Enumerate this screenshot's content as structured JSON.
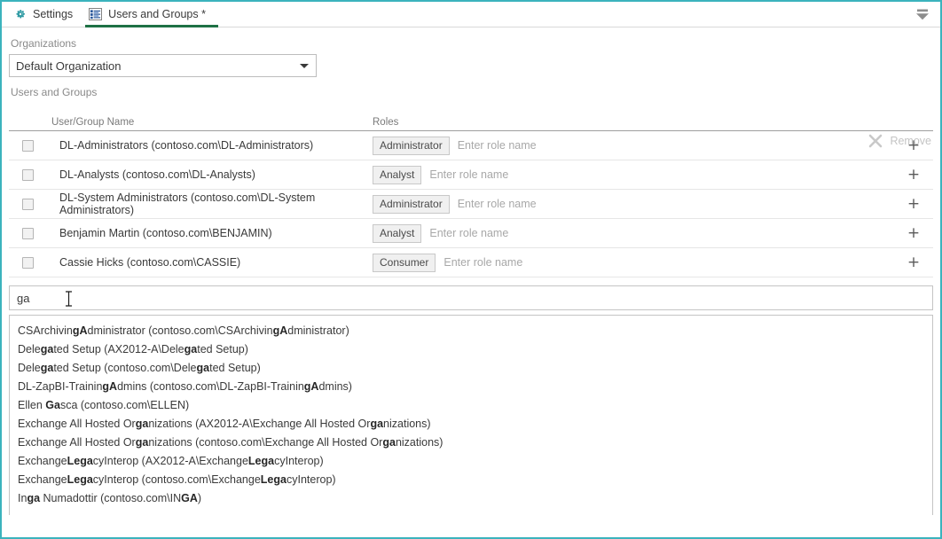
{
  "window": {
    "accent_color": "#3bb3bd",
    "active_tab_underline": "#1e7145"
  },
  "tabs": [
    {
      "label": "Settings",
      "icon": "gear-icon",
      "active": false
    },
    {
      "label": "Users and Groups *",
      "icon": "list-form-icon",
      "active": true
    }
  ],
  "toolbar": {
    "filter_icon": "funnel-icon",
    "remove_label": "Remove",
    "remove_icon": "x-icon"
  },
  "organizations": {
    "label": "Organizations",
    "selected": "Default Organization",
    "caret_icon": "chevron-down-icon"
  },
  "users_and_groups": {
    "label": "Users and Groups",
    "columns": {
      "name": "User/Group Name",
      "roles": "Roles"
    },
    "role_placeholder": "Enter role name",
    "add_icon": "plus-icon",
    "rows": [
      {
        "name": "DL-Administrators (contoso.com\\DL-Administrators)",
        "role": "Administrator",
        "checked": false
      },
      {
        "name": "DL-Analysts (contoso.com\\DL-Analysts)",
        "role": "Analyst",
        "checked": false
      },
      {
        "name": "DL-System Administrators (contoso.com\\DL-System Administrators)",
        "role": "Administrator",
        "checked": false
      },
      {
        "name": "Benjamin Martin (contoso.com\\BENJAMIN)",
        "role": "Analyst",
        "checked": false
      },
      {
        "name": "Cassie Hicks (contoso.com\\CASSIE)",
        "role": "Consumer",
        "checked": false
      }
    ]
  },
  "search": {
    "value": "ga",
    "placeholder": "",
    "cursor_icon": "text-ibeam-cursor"
  },
  "suggestions": {
    "match": "ga",
    "items": [
      {
        "html": "CSArchivin<b>gA</b>dministrator (contoso.com\\CSArchivin<b>gA</b>dministrator)"
      },
      {
        "html": "Dele<b>ga</b>ted Setup (AX2012-A\\Dele<b>ga</b>ted Setup)"
      },
      {
        "html": "Dele<b>ga</b>ted Setup (contoso.com\\Dele<b>ga</b>ted Setup)"
      },
      {
        "html": "DL-ZapBI-Trainin<b>gA</b>dmins (contoso.com\\DL-ZapBI-Trainin<b>gA</b>dmins)"
      },
      {
        "html": "Ellen <b>Ga</b>sca (contoso.com\\ELLEN)"
      },
      {
        "html": "Exchange All Hosted Or<b>ga</b>nizations (AX2012-A\\Exchange All Hosted Or<b>ga</b>nizations)"
      },
      {
        "html": "Exchange All Hosted Or<b>ga</b>nizations (contoso.com\\Exchange All Hosted Or<b>ga</b>nizations)"
      },
      {
        "html": "Exchange<b>Lega</b>cyInterop (AX2012-A\\Exchange<b>Lega</b>cyInterop)"
      },
      {
        "html": "Exchange<b>Lega</b>cyInterop (contoso.com\\Exchange<b>Lega</b>cyInterop)"
      },
      {
        "html": "In<b>ga</b> Numadottir (contoso.com\\IN<b>GA</b>)"
      }
    ]
  }
}
